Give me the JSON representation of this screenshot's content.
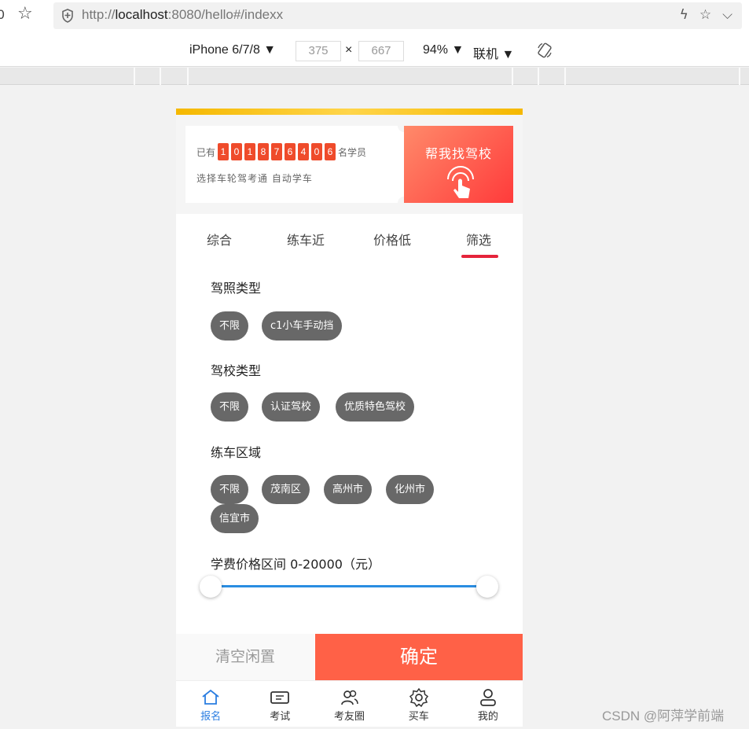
{
  "browser": {
    "url_prefix": "http://",
    "url_host": "localhost",
    "url_rest": ":8080/hello#/indexx",
    "left_glyph": "0"
  },
  "device_toolbar": {
    "device": "iPhone 6/7/8 ▼",
    "width": "375",
    "times": "×",
    "height": "667",
    "zoom": "94% ▼",
    "network": "联机 ▼"
  },
  "banner": {
    "prefix": "已有",
    "digits": [
      "1",
      "0",
      "1",
      "8",
      "7",
      "6",
      "4",
      "0",
      "6"
    ],
    "suffix": "名学员",
    "line2": "选择车轮驾考通  自动学车",
    "cta": "帮我找驾校"
  },
  "tabs": [
    {
      "label": "综合"
    },
    {
      "label": "练车近"
    },
    {
      "label": "价格低"
    },
    {
      "label": "筛选"
    }
  ],
  "filters": {
    "license": {
      "title": "驾照类型",
      "options": [
        "不限",
        "c1小车手动挡"
      ]
    },
    "school": {
      "title": "驾校类型",
      "options": [
        "不限",
        "认证驾校",
        "优质特色驾校"
      ]
    },
    "area": {
      "title": "练车区域",
      "options": [
        "不限",
        "茂南区",
        "高州市",
        "化州市",
        "信宜市"
      ]
    },
    "price": {
      "title": "学费价格区间 0-20000（元）",
      "min": 0,
      "max": 20000
    }
  },
  "actions": {
    "clear": "清空闲置",
    "confirm": "确定"
  },
  "bottom_nav": [
    {
      "label": "报名",
      "icon": "home-icon",
      "active": true
    },
    {
      "label": "考试",
      "icon": "ticket-icon",
      "active": false
    },
    {
      "label": "考友圈",
      "icon": "friends-icon",
      "active": false
    },
    {
      "label": "买车",
      "icon": "gear-icon",
      "active": false
    },
    {
      "label": "我的",
      "icon": "user-icon",
      "active": false
    }
  ],
  "colors": {
    "accent_blue": "#2a7de1",
    "confirm_red": "#ff6147",
    "tab_underline": "#e5243b",
    "chip_gray": "#686868"
  },
  "watermark": "CSDN @阿萍学前端"
}
